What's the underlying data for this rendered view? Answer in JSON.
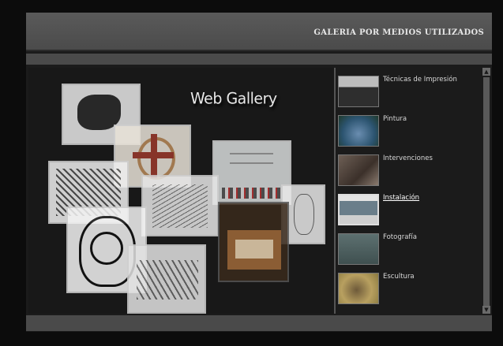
{
  "header": {
    "title": "GALERIA POR MEDIOS UTILIZADOS"
  },
  "gallery": {
    "title": "Web Gallery"
  },
  "categories": [
    {
      "label": "Técnicas de Impresión",
      "active": false
    },
    {
      "label": "Pintura",
      "active": false
    },
    {
      "label": "Intervenciones",
      "active": false
    },
    {
      "label": "Instalación",
      "active": true
    },
    {
      "label": "Fotografía",
      "active": false
    },
    {
      "label": "Escultura",
      "active": false
    }
  ],
  "scrollbar": {
    "up_glyph": "▲",
    "down_glyph": "▼"
  }
}
